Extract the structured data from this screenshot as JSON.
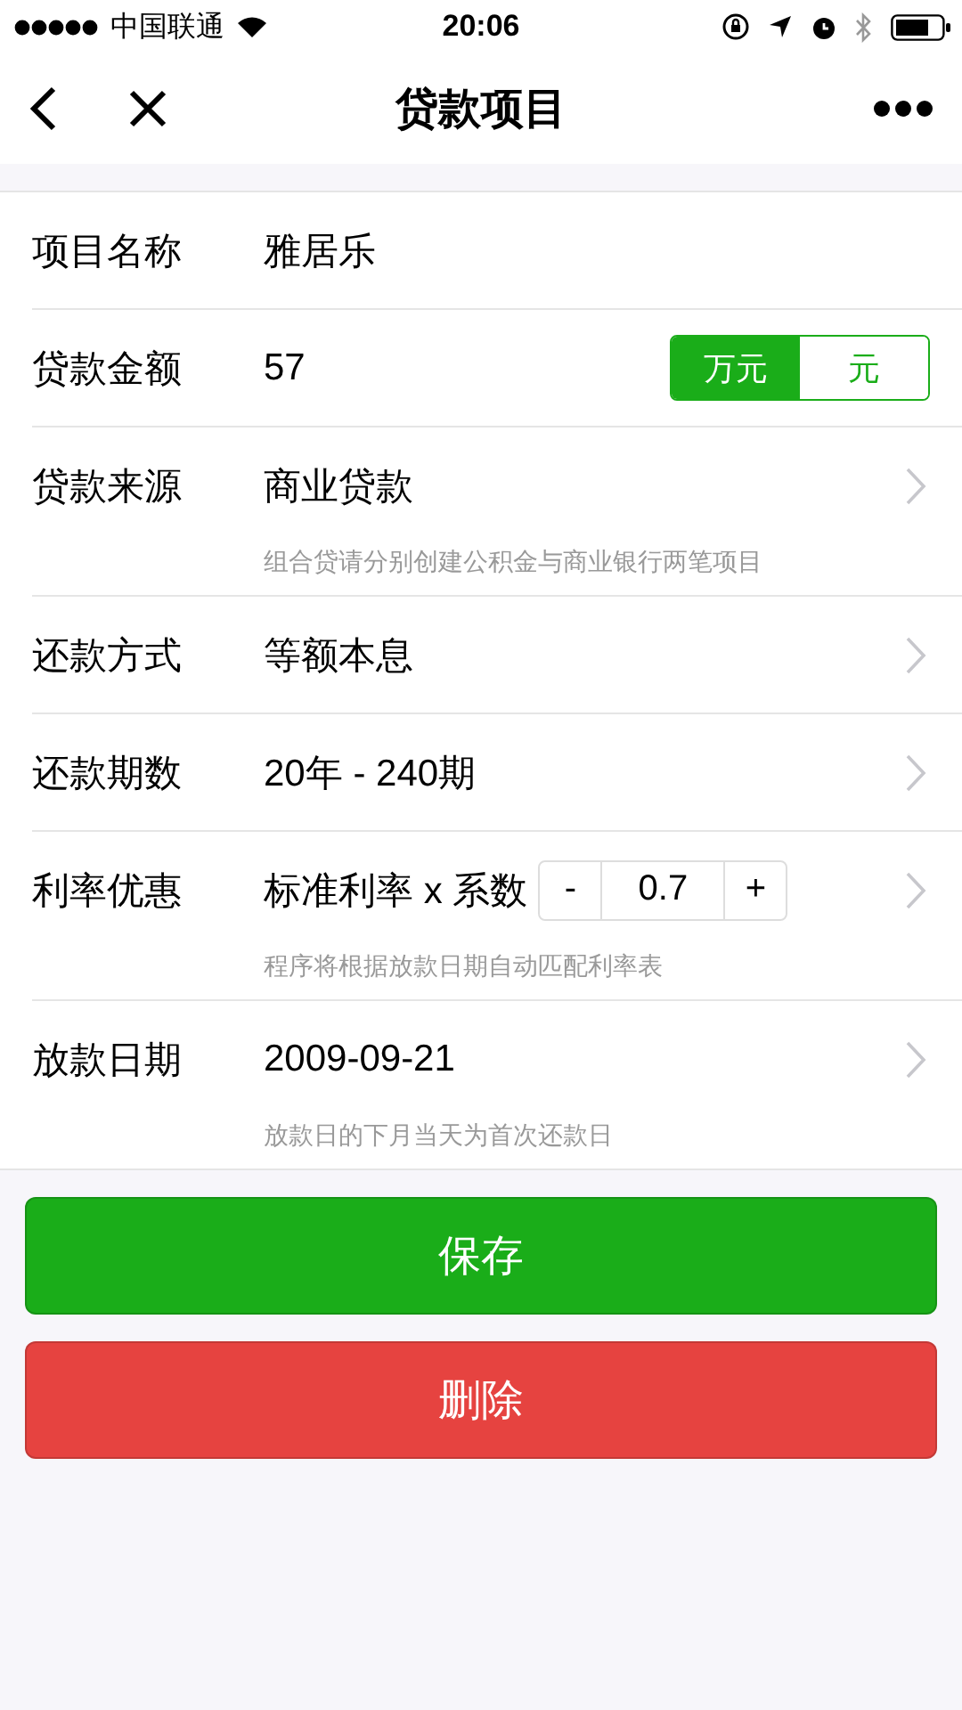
{
  "status_bar": {
    "carrier": "中国联通",
    "time": "20:06"
  },
  "nav": {
    "title": "贷款项目"
  },
  "rows": [
    {
      "kind": "text",
      "label": "项目名称",
      "value": "雅居乐"
    },
    {
      "kind": "unit",
      "label": "贷款金额",
      "value": "57",
      "units": [
        {
          "label": "万元",
          "selected": true
        },
        {
          "label": "元",
          "selected": false
        }
      ]
    },
    {
      "kind": "select",
      "label": "贷款来源",
      "value": "商业贷款",
      "hint": "组合贷请分别创建公积金与商业银行两笔项目"
    },
    {
      "kind": "select",
      "label": "还款方式",
      "value": "等额本息"
    },
    {
      "kind": "select",
      "label": "还款期数",
      "value": "20年 - 240期"
    },
    {
      "kind": "stepper",
      "label": "利率优惠",
      "value": "标准利率 x 系数",
      "minus": "-",
      "amount": "0.7",
      "plus": "+",
      "hint": "程序将根据放款日期自动匹配利率表"
    },
    {
      "kind": "select",
      "label": "放款日期",
      "value": "2009-09-21",
      "hint": "放款日的下月当天为首次还款日"
    }
  ],
  "buttons": [
    {
      "kind": "primary",
      "label": "保存"
    },
    {
      "kind": "danger",
      "label": "删除"
    }
  ]
}
